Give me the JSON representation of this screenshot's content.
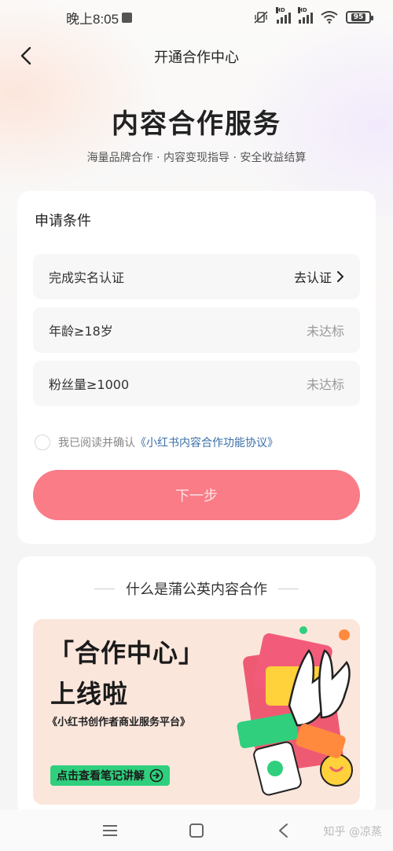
{
  "status_bar": {
    "time": "晚上8:05",
    "battery": "95"
  },
  "nav": {
    "title": "开通合作中心"
  },
  "hero": {
    "title": "内容合作服务",
    "subtitle": "海量品牌合作 · 内容变现指导 · 安全收益结算"
  },
  "conditions": {
    "heading": "申请条件",
    "items": [
      {
        "label": "完成实名认证",
        "action": "去认证"
      },
      {
        "label": "年龄≥18岁",
        "status": "未达标"
      },
      {
        "label": "粉丝量≥1000",
        "status": "未达标"
      }
    ],
    "agreement_prefix": "我已阅读并确认",
    "agreement_link": "《小红书内容合作功能协议》",
    "next_button": "下一步"
  },
  "intro": {
    "heading": "什么是蒲公英内容合作",
    "banner": {
      "title_line1": "「合作中心」",
      "title_line2": "上线啦",
      "subtitle": "《小红书创作者商业服务平台》",
      "button": "点击查看笔记讲解"
    }
  },
  "watermark": "知乎 @凉蒸",
  "colors": {
    "accent": "#f97c87",
    "link": "#3a6fa8",
    "banner_bg": "#fbe6dc",
    "banner_button": "#2fcf7d"
  }
}
